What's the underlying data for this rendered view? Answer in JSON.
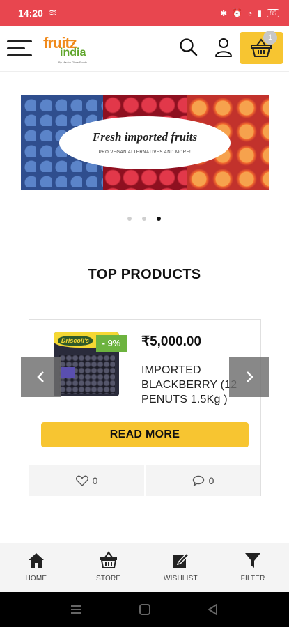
{
  "status_bar": {
    "time": "14:20",
    "battery": "85"
  },
  "header": {
    "logo_top": "fruitz",
    "logo_bottom": "india",
    "logo_tagline": "By Madhu Glore Foods",
    "cart_count": "1"
  },
  "banner": {
    "title": "Fresh imported fruits",
    "subtitle": "PRO VEGAN ALTERNATIVES AND MORE!",
    "slides": 3,
    "active_slide": 3
  },
  "section_title": "TOP PRODUCTS",
  "product": {
    "discount": "- 9%",
    "price": "₹5,000.00",
    "name": "IMPORTED BLACKBERRY (12 PENUTS 1.5Kg )",
    "brand": "Driscoll's",
    "read_more": "READ MORE",
    "likes": "0",
    "comments": "0"
  },
  "bottom_nav": [
    {
      "label": "HOME",
      "icon": "home-icon"
    },
    {
      "label": "STORE",
      "icon": "store-basket-icon"
    },
    {
      "label": "WISHLIST",
      "icon": "edit-icon"
    },
    {
      "label": "FILTER",
      "icon": "filter-icon"
    }
  ],
  "colors": {
    "status_bar": "#e8464f",
    "accent": "#f7c531",
    "discount": "#6db33f"
  }
}
